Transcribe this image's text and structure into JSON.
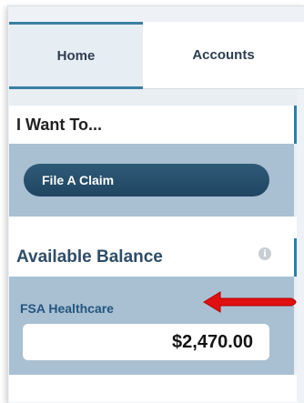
{
  "tabs": [
    {
      "label": "Home",
      "active": true
    },
    {
      "label": "Accounts",
      "active": false
    }
  ],
  "sections": {
    "want": {
      "title": "I Want To...",
      "button_label": "File A Claim"
    },
    "balance": {
      "title": "Available Balance",
      "info_icon": "info-icon",
      "account_label": "FSA Healthcare",
      "amount": "$2,470.00"
    }
  },
  "colors": {
    "accent": "#2b7fa6",
    "button": "#1f4661",
    "section_body": "#a9c0d2",
    "arrow": "#e01010"
  }
}
